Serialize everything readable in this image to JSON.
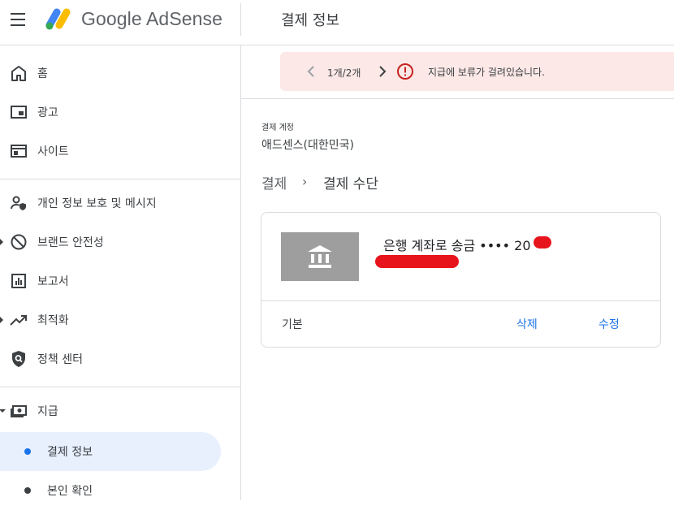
{
  "header": {
    "logo_text": "Google AdSense",
    "page_title": "결제 정보",
    "brand_colors": {
      "blue": "#4285f4",
      "yellow": "#fbbc04",
      "green": "#34a853"
    }
  },
  "sidebar": {
    "items": [
      {
        "label": "홈",
        "icon": "home-icon"
      },
      {
        "label": "광고",
        "icon": "ads-icon"
      },
      {
        "label": "사이트",
        "icon": "sites-icon"
      },
      {
        "label": "개인 정보 보호 및 메시지",
        "icon": "privacy-icon"
      },
      {
        "label": "브랜드 안전성",
        "icon": "block-icon"
      },
      {
        "label": "보고서",
        "icon": "reports-icon"
      },
      {
        "label": "최적화",
        "icon": "trending-icon"
      },
      {
        "label": "정책 센터",
        "icon": "policy-icon"
      },
      {
        "label": "지급",
        "icon": "payments-icon"
      }
    ],
    "sub_items": [
      {
        "label": "결제 정보",
        "active": true
      },
      {
        "label": "본인 확인",
        "active": false
      }
    ],
    "active_color": "#e8f0fe"
  },
  "banner": {
    "counter": "1개/2개",
    "message": "지급에 보류가 걸려있습니다.",
    "alert_color": "#c5221f"
  },
  "account": {
    "label": "결제 계정",
    "name": "애드센스(대한민국)"
  },
  "breadcrumb": {
    "parent": "결제",
    "separator": "›",
    "current": "결제 수단"
  },
  "payment_card": {
    "title": "은행 계좌로 송금 •••• 20",
    "default_label": "기본",
    "delete_label": "삭제",
    "edit_label": "수정"
  }
}
